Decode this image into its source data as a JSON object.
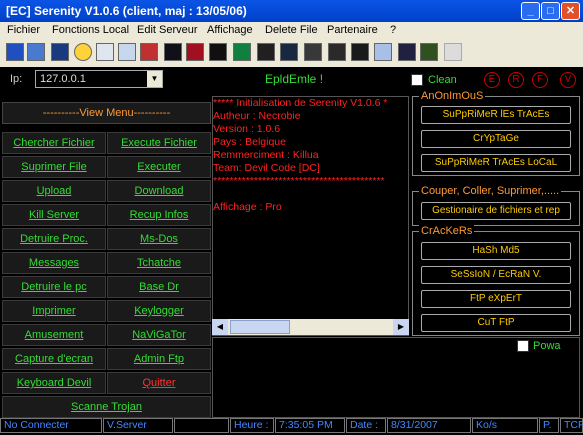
{
  "window": {
    "title": "[EC] Serenity V1.0.6 (client, maj : 13/05/06)"
  },
  "menu": [
    "Fichier",
    "Fonctions Local",
    "Edit Serveur",
    "Affichage",
    "Delete File",
    "Partenaire",
    "?"
  ],
  "ip": {
    "label": "Ip:",
    "value": "127.0.0.1",
    "status": "EpldEmle !",
    "clean_label": "Clean",
    "buttons": [
      "E",
      "R",
      "F",
      "V"
    ]
  },
  "left_menu": {
    "header": "----------View Menu----------",
    "buttons": [
      "Chercher Fichier",
      "Execute Fichier",
      "Suprimer File",
      "Executer",
      "Upload",
      "Download",
      "Kill Server",
      "Recup Infos",
      "Detruire Proc.",
      "Ms-Dos",
      "Messages",
      "Tchatche",
      "Detruire le pc",
      "Base Dr",
      "Imprimer",
      "Keylogger",
      "Amusement",
      "NaViGaTor",
      "Capture d'ecran",
      "Admin Ftp",
      "Keyboard Devil",
      "Quitter"
    ],
    "scan": "Scanne Trojan"
  },
  "console": {
    "lines": [
      "***** Initialisation de Serenity V1.0.6 *",
      "Autheur : Necrobie",
      "Version : 1.0.6",
      "Pays : Belgique",
      "Remmerciment : Killua",
      "Team: Devil Code [DC]",
      "******************************************",
      "",
      "Affichage : Pro"
    ]
  },
  "groups": {
    "anonimous": {
      "title": "AnOnImOuS",
      "buttons": [
        "SuPpRiMeR lEs TrAcEs",
        "CrYpTaGe",
        "SuPpRiMeR TrAcEs LoCaL"
      ]
    },
    "files": {
      "title": "Couper, Coller, Suprimer,.....",
      "buttons": [
        "Gestionaire de fichiers et rep"
      ]
    },
    "crackers": {
      "title": "CrAcKeRs",
      "buttons": [
        "HaSh Md5",
        "SeSsIoN / EcRaN V.",
        "FtP eXpErT",
        "CuT FtP"
      ]
    }
  },
  "powa_label": "Powa",
  "status": {
    "connection": "No Connecter",
    "server": "V.Server",
    "heure_label": "Heure :",
    "heure": "7:35:05 PM",
    "date_label": "Date :",
    "date": "8/31/2007",
    "speed": "Ko/s",
    "p": "P.",
    "tcp": "TCP"
  }
}
